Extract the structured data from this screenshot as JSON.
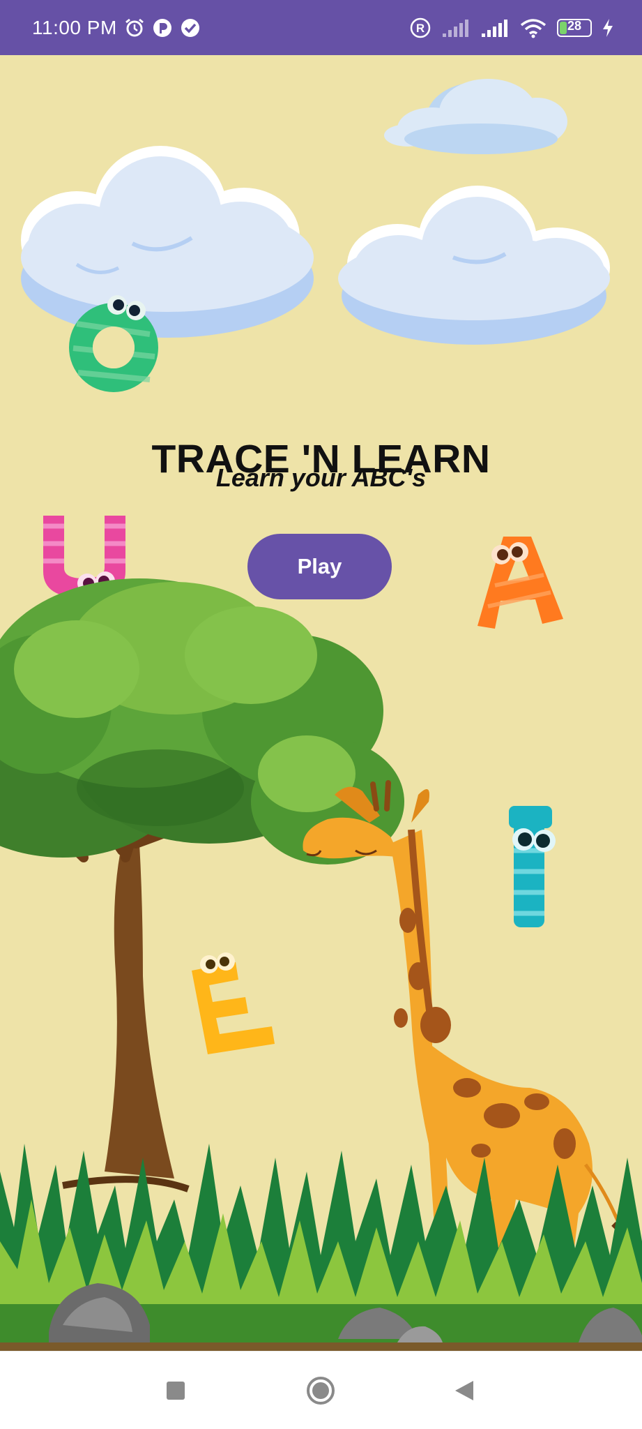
{
  "status_bar": {
    "time": "11:00 PM",
    "battery_level": "28",
    "icons": [
      "alarm-icon",
      "app-notification-icon",
      "check-badge-icon",
      "registered-icon",
      "signal-icon",
      "signal-icon",
      "wifi-icon",
      "battery-icon",
      "charging-icon"
    ]
  },
  "app": {
    "title": "TRACE 'N LEARN",
    "subtitle": "Learn your ABC's",
    "play_label": "Play"
  },
  "scene": {
    "characters": [
      "O",
      "U",
      "A",
      "I",
      "E"
    ],
    "background_color": "#eee3a8",
    "accent_color": "#6752a8"
  },
  "nav_bar": {
    "icons": [
      "recents-square-icon",
      "home-circle-icon",
      "back-triangle-icon"
    ]
  }
}
